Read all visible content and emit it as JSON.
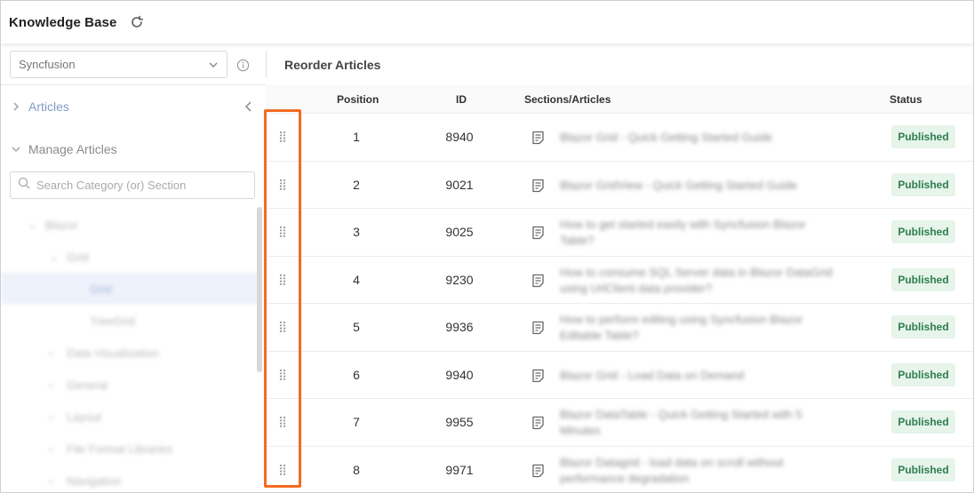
{
  "header": {
    "title": "Knowledge Base",
    "refresh_icon": "refresh-icon"
  },
  "sidebar": {
    "dropdown_value": "Syncfusion",
    "nav": [
      {
        "label": "Articles",
        "state": "collapsed"
      },
      {
        "label": "Manage Articles",
        "state": "expanded"
      }
    ],
    "search_placeholder": "Search Category (or) Section",
    "tree": [
      {
        "label": "Blazor",
        "level": 0,
        "expanded": true
      },
      {
        "label": "Grid",
        "level": 1,
        "expanded": true
      },
      {
        "label": "Grid",
        "level": 2,
        "selected": true
      },
      {
        "label": "TreeGrid",
        "level": 2
      },
      {
        "label": "Data Visualization",
        "level": 1
      },
      {
        "label": "General",
        "level": 1
      },
      {
        "label": "Layout",
        "level": 1
      },
      {
        "label": "File Format Libraries",
        "level": 1
      },
      {
        "label": "Navigation",
        "level": 1
      }
    ]
  },
  "main": {
    "title": "Reorder Articles",
    "columns": {
      "position": "Position",
      "id": "ID",
      "sections": "Sections/Articles",
      "status": "Status"
    },
    "rows": [
      {
        "position": "1",
        "id": "8940",
        "article": "Blazor Grid - Quick Getting Started Guide",
        "status": "Published"
      },
      {
        "position": "2",
        "id": "9021",
        "article": "Blazor GridView - Quick Getting Started Guide",
        "status": "Published"
      },
      {
        "position": "3",
        "id": "9025",
        "article": "How to get started easily with Syncfusion Blazor Table?",
        "status": "Published"
      },
      {
        "position": "4",
        "id": "9230",
        "article": "How to consume SQL Server data in Blazor DataGrid using UrlClient data provider?",
        "status": "Published"
      },
      {
        "position": "5",
        "id": "9936",
        "article": "How to perform editing using Syncfusion Blazor Editable Table?",
        "status": "Published"
      },
      {
        "position": "6",
        "id": "9940",
        "article": "Blazor Grid - Load Data on Demand",
        "status": "Published"
      },
      {
        "position": "7",
        "id": "9955",
        "article": "Blazor DataTable - Quick Getting Started with 5 Minutes",
        "status": "Published"
      },
      {
        "position": "8",
        "id": "9971",
        "article": "Blazor Datagrid - load data on scroll without performance degradation",
        "status": "Published"
      }
    ]
  },
  "colors": {
    "accent": "#f36b21",
    "badge_bg": "#e6f4ea",
    "badge_text": "#2e7d4f",
    "nav_active": "#7f9cc8"
  }
}
